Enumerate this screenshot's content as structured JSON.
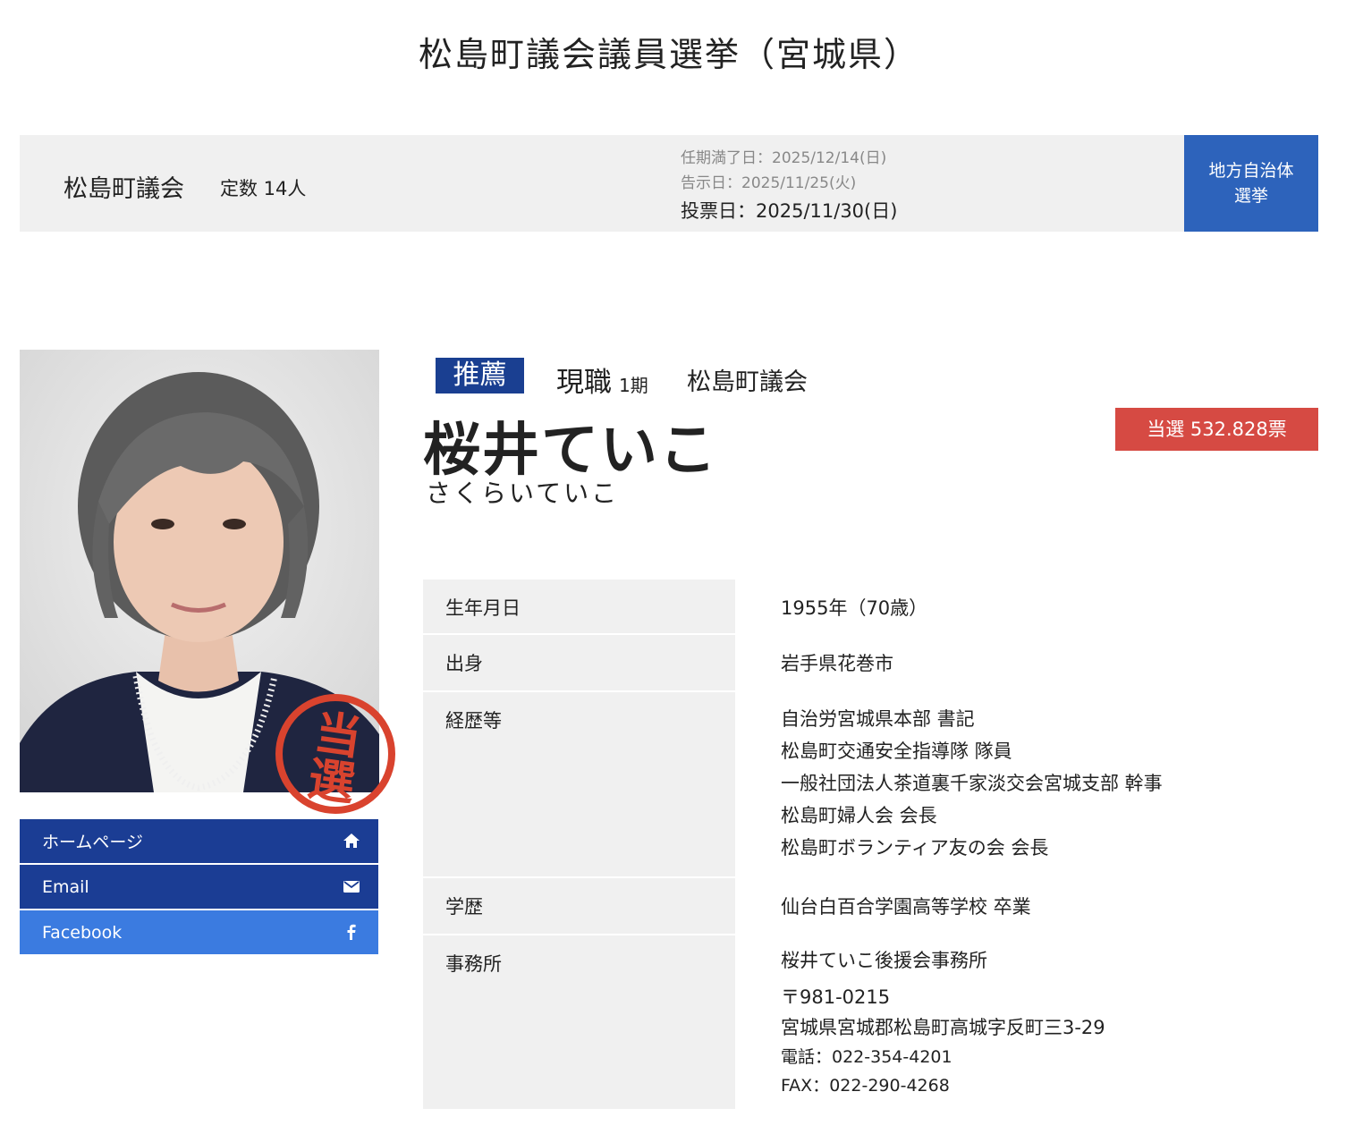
{
  "page": {
    "title": "松島町議会議員選挙（宮城県）"
  },
  "election": {
    "council": "松島町議会",
    "seats": "定数 14人",
    "term_end": "任期満了日：2025/12/14(日)",
    "announce": "告示日：2025/11/25(火)",
    "vote_day": "投票日：2025/11/30(日)",
    "type_line1": "地方自治体",
    "type_line2": "選挙"
  },
  "candidate": {
    "recommend": "推薦",
    "status": "現職",
    "term": "1期",
    "council": "松島町議会",
    "name": "桜井ていこ",
    "kana": "さくらいていこ",
    "result": "当選 532.828票",
    "stamp_text": "当選"
  },
  "links": [
    {
      "label": "ホームページ",
      "icon": "home-icon",
      "color": "#1b3d94"
    },
    {
      "label": "Email",
      "icon": "envelope-icon",
      "color": "#1b3d94"
    },
    {
      "label": "Facebook",
      "icon": "facebook-icon",
      "color": "#3b7be0"
    }
  ],
  "profile": {
    "birth_label": "生年月日",
    "birth_value": "1955年（70歳）",
    "origin_label": "出身",
    "origin_value": "岩手県花巻市",
    "career_label": "経歴等",
    "career": [
      "自治労宮城県本部 書記",
      "松島町交通安全指導隊 隊員",
      "一般社団法人茶道裏千家淡交会宮城支部 幹事",
      "松島町婦人会 会長",
      "松島町ボランティア友の会 会長"
    ],
    "edu_label": "学歴",
    "edu_value": "仙台白百合学園高等学校 卒業",
    "office_label": "事務所",
    "office_name": "桜井ていこ後援会事務所",
    "office_zip": "〒981-0215",
    "office_address": "宮城県宮城郡松島町高城字反町三3-29",
    "office_tel": "電話：022-354-4201",
    "office_fax": "FAX：022-290-4268"
  },
  "colors": {
    "accent_blue": "#2d63bb",
    "dark_blue": "#1b3d94",
    "result_red": "#d64a43",
    "stamp_red": "#d9432e"
  }
}
